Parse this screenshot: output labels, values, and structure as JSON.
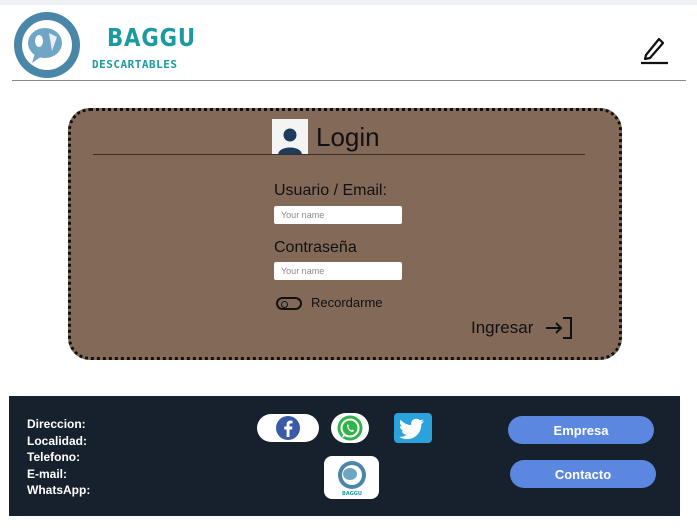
{
  "brand": {
    "name": "BAGGU",
    "subtitle": "DESCARTABLES",
    "color": "#1b9aa0",
    "logo_small_text": "BAGGU"
  },
  "header": {
    "edit_icon": "edit-pencil-icon"
  },
  "login": {
    "title": "Login",
    "user_icon": "user-icon",
    "user_label": "Usuario / Email:",
    "user_placeholder": "Your name",
    "user_value": "",
    "password_label": "Contraseña",
    "password_placeholder": "Your name",
    "password_value": "",
    "remember_label": "Recordarme",
    "remember_checked": false,
    "submit_label": "Ingresar",
    "submit_icon": "login-arrow-icon",
    "card_color": "#836957"
  },
  "footer": {
    "background": "#17212e",
    "contact_lines": [
      "Direccion:",
      "Localidad:",
      "Telefono:",
      "E-mail:",
      "WhatsApp:"
    ],
    "social": {
      "facebook_icon": "facebook-icon",
      "whatsapp_icon": "whatsapp-icon",
      "twitter_icon": "twitter-icon"
    },
    "buttons": {
      "empresa": "Empresa",
      "contacto": "Contacto"
    },
    "accent": "#5b87e0"
  }
}
